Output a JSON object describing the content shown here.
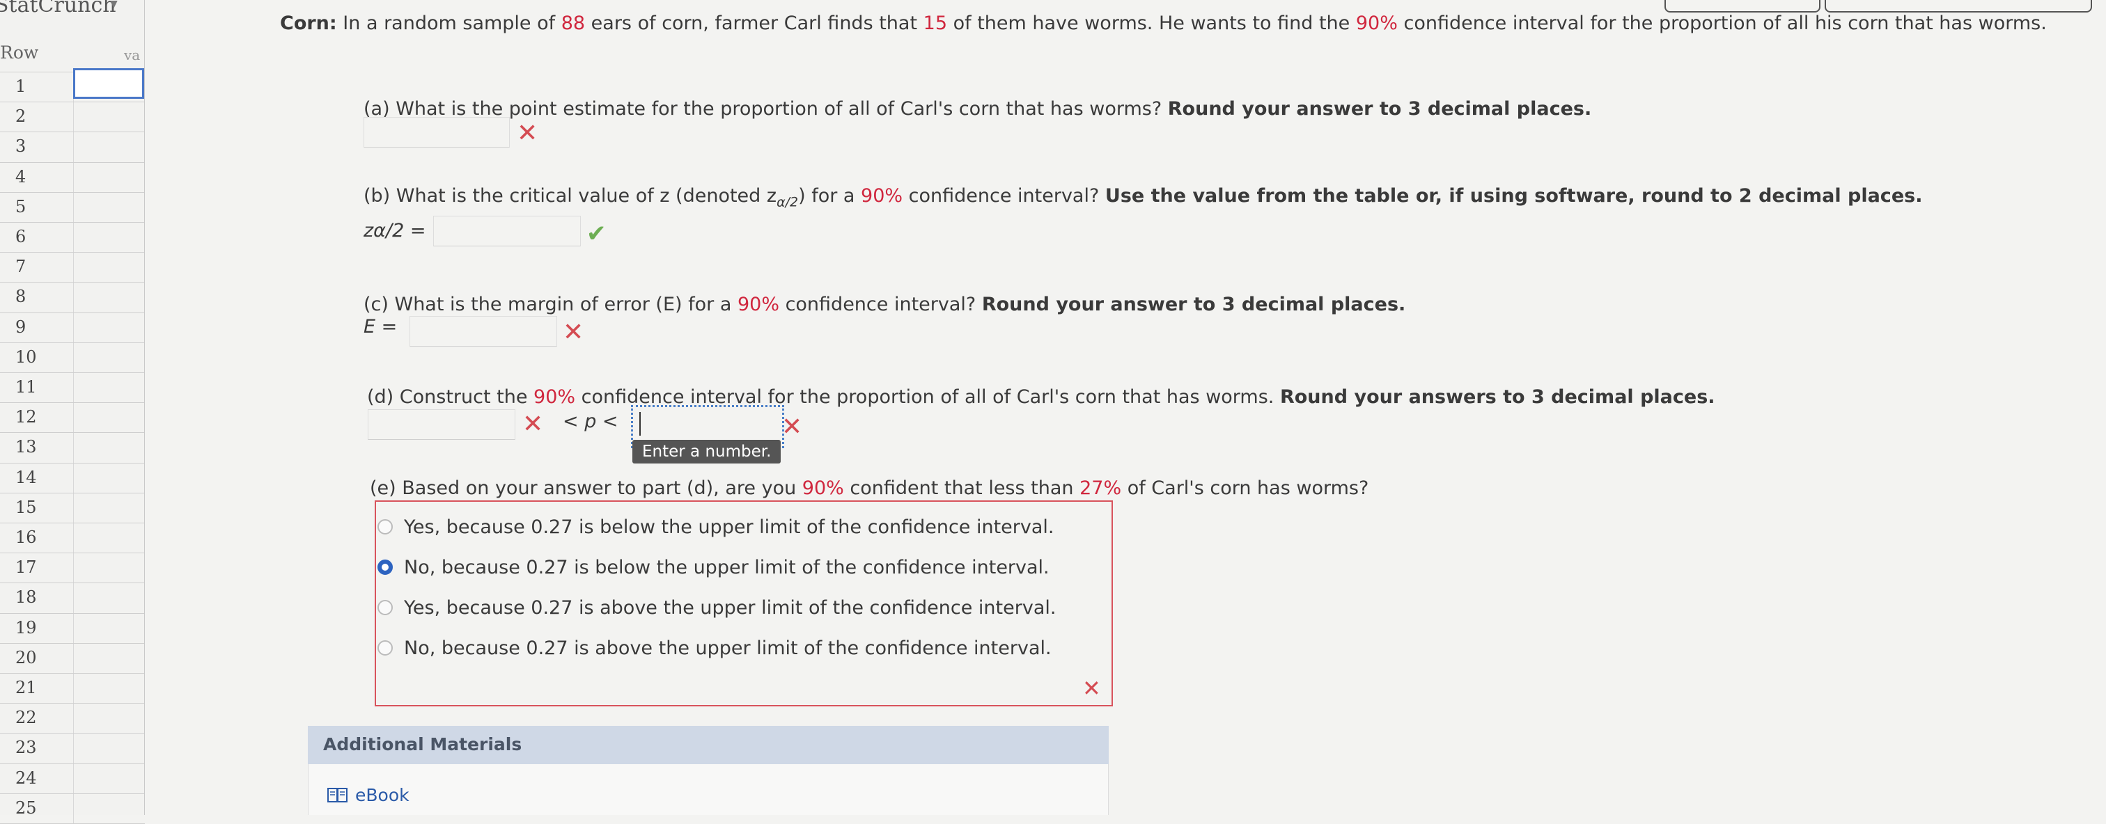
{
  "sidebar": {
    "app_title": "StatCrunch",
    "header": {
      "row": "Row",
      "var": "va"
    },
    "rows": [
      "1",
      "2",
      "3",
      "4",
      "5",
      "6",
      "7",
      "8",
      "9",
      "10",
      "11",
      "12",
      "13",
      "14",
      "15",
      "16",
      "17",
      "18",
      "19",
      "20",
      "21",
      "22",
      "23",
      "24",
      "25"
    ]
  },
  "question": {
    "label": "Corn:",
    "text_1": " In a random sample of ",
    "n": "88",
    "text_2": " ears of corn, farmer Carl finds that ",
    "x": "15",
    "text_3": " of them have worms. He wants to find the ",
    "conf": "90%",
    "text_4": " confidence interval for the proportion of all his corn that has worms."
  },
  "part_a": {
    "text": "(a) What is the point estimate for the proportion of all of Carl's corn that has worms? ",
    "bold": "Round your answer to 3 decimal places.",
    "status": "incorrect"
  },
  "part_b": {
    "text_1": "(b) What is the critical value of z (denoted z",
    "sub": "α/2",
    "text_2": ") for a ",
    "conf": "90%",
    "text_3": " confidence interval? ",
    "bold": "Use the value from the table or, if using software, round to 2 decimal places.",
    "label": "zα/2 =",
    "status": "correct"
  },
  "part_c": {
    "text_1": "(c) What is the margin of error (E) for a ",
    "conf": "90%",
    "text_2": " confidence interval? ",
    "bold": "Round your answer to 3 decimal places.",
    "label": "E =",
    "status": "incorrect"
  },
  "part_d": {
    "text_1": "(d) Construct the ",
    "conf": "90%",
    "text_2": " confidence interval for the proportion of all of Carl's corn that has worms. ",
    "bold": "Round your answers to 3 decimal places.",
    "middle": "< p <",
    "tooltip": "Enter a number."
  },
  "part_e": {
    "text_1": "(e) Based on your answer to part (d), are you ",
    "conf": "90%",
    "text_2": " confident that less than ",
    "pct": "27%",
    "text_3": " of Carl's corn has worms?",
    "options": [
      "Yes, because 0.27 is below the upper limit of the confidence interval.",
      "No, because 0.27 is below the upper limit of the confidence interval.",
      "Yes, because 0.27 is above the upper limit of the confidence interval.",
      "No, because 0.27 is above the upper limit of the confidence interval."
    ],
    "selected_index": 1,
    "status": "incorrect"
  },
  "additional": {
    "title": "Additional Materials",
    "ebook": "eBook"
  },
  "colors": {
    "accent_red": "#d0273e",
    "wrong": "#d44b52",
    "right": "#6cae52",
    "selected_radio": "#2d63c0"
  },
  "icons": {
    "wrong": "x-icon",
    "right": "check-icon",
    "book": "book-icon"
  }
}
